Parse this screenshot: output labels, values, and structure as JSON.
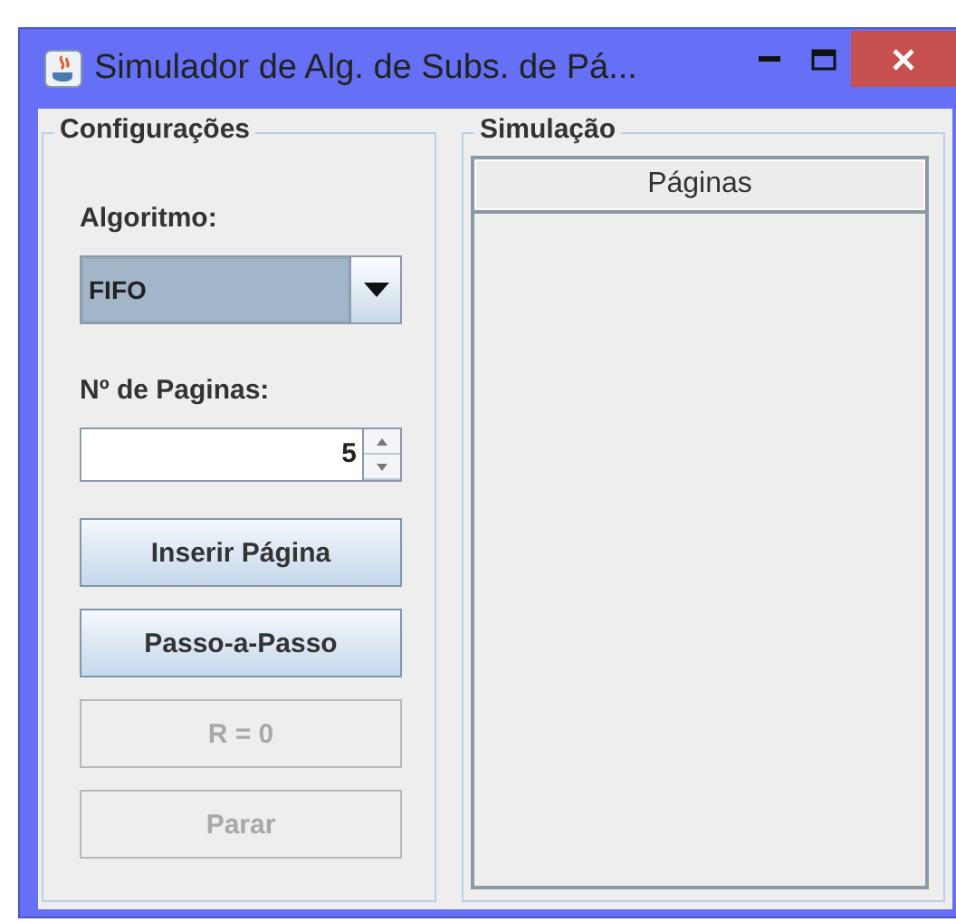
{
  "window": {
    "title": "Simulador de Alg. de Subs. de Pá..."
  },
  "configuracoes": {
    "title": "Configurações",
    "algorithm_label": "Algoritmo:",
    "algorithm": {
      "value": "FIFO"
    },
    "pages_label": "Nº de Paginas:",
    "pages": {
      "value": "5"
    },
    "buttons": [
      {
        "label": "Inserir Página",
        "disabled": false
      },
      {
        "label": "Passo-a-Passo",
        "disabled": false
      },
      {
        "label": "R = 0",
        "disabled": true
      },
      {
        "label": "Parar",
        "disabled": true
      }
    ]
  },
  "simulacao": {
    "title": "Simulação",
    "table": {
      "columns": [
        "Páginas"
      ]
    }
  }
}
